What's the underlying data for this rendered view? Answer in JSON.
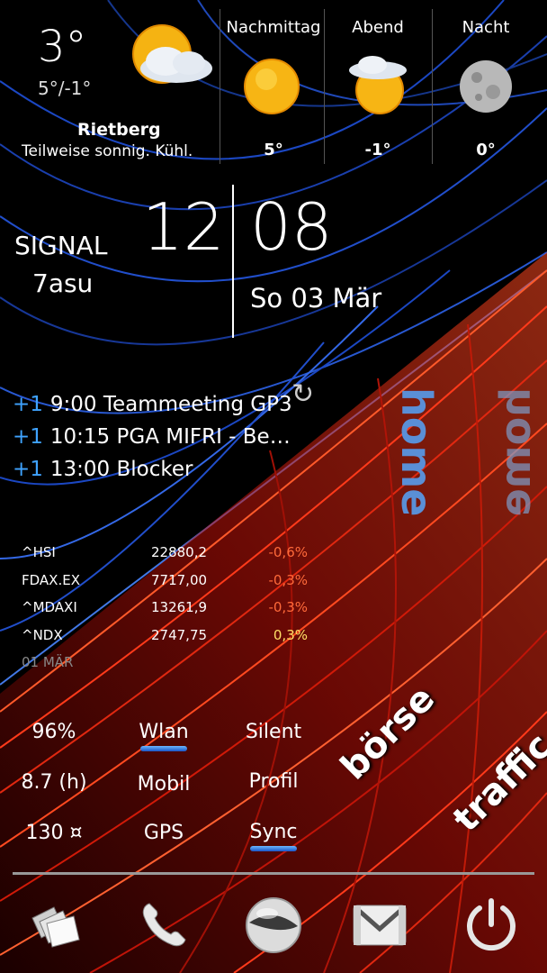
{
  "weather": {
    "current_temp": "3°",
    "range": "5°/-1°",
    "location": "Rietberg",
    "condition": "Teilweise sonnig. Kühl.",
    "forecast": [
      {
        "label": "Nachmittag",
        "temp": "5°",
        "icon": "sun-icon"
      },
      {
        "label": "Abend",
        "temp": "-1°",
        "icon": "partly-cloudy-icon"
      },
      {
        "label": "Nacht",
        "temp": "0°",
        "icon": "moon-icon"
      }
    ]
  },
  "clock": {
    "signal_label": "SIGNAL",
    "signal_sub": "7asu",
    "hour": "12",
    "minute": "08",
    "date": "So 03 Mär"
  },
  "calendar": {
    "events": [
      {
        "plus": "+1",
        "text": "9:00 Teammeeting GP3"
      },
      {
        "plus": "+1",
        "text": "10:15 PGA MIFRI - Be…"
      },
      {
        "plus": "+1",
        "text": "13:00 Blocker"
      }
    ]
  },
  "stocks": {
    "rows": [
      {
        "name": "^HSI",
        "value": "22880,2",
        "change": "-0,6%"
      },
      {
        "name": "FDAX.EX",
        "value": "7717,00",
        "change": "-0,3%"
      },
      {
        "name": "^MDAXI",
        "value": "13261,9",
        "change": "-0,3%"
      },
      {
        "name": "^NDX",
        "value": "2747,75",
        "change": "0,3%"
      }
    ],
    "date": "01 MÄR"
  },
  "toggles": {
    "battery": "96%",
    "hours": "8.7 (h)",
    "count": "130 ¤",
    "wlan": "Wlan",
    "mobil": "Mobil",
    "gps": "GPS",
    "silent": "Silent",
    "profil": "Profil",
    "sync": "Sync"
  },
  "shortcuts": {
    "home": "home",
    "boerse": "börse",
    "traffic": "traffic"
  },
  "dock": [
    "cards-icon",
    "phone-icon",
    "globe-icon",
    "mail-icon",
    "power-icon"
  ],
  "colors": {
    "accent_blue": "#3fa3ff",
    "negative": "#ff6a3a",
    "positive": "#ffe066"
  }
}
